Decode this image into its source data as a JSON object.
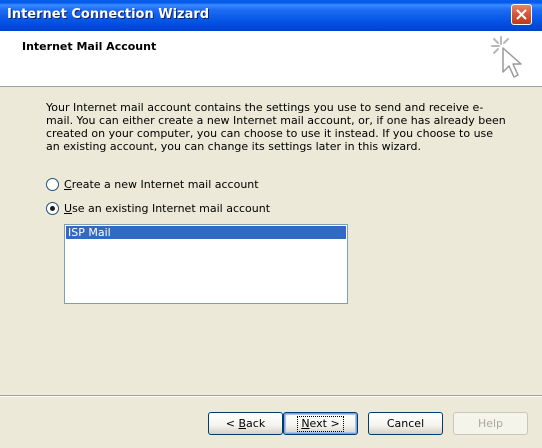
{
  "window": {
    "title": "Internet Connection Wizard"
  },
  "header": {
    "title": "Internet Mail Account"
  },
  "body": {
    "description": "Your Internet mail account contains the settings you use to send and receive e-mail. You can either create a new Internet mail account, or, if one has already been created on your computer, you can choose to use it instead. If you choose to use an existing account, you can change its settings later in this wizard."
  },
  "options": [
    {
      "label_prefix": "",
      "accel": "C",
      "label_rest": "reate a new Internet mail account",
      "checked": false
    },
    {
      "label_prefix": "",
      "accel": "U",
      "label_rest": "se an existing Internet mail account",
      "checked": true
    }
  ],
  "accounts": {
    "items": [
      "ISP Mail"
    ],
    "selected": "ISP Mail"
  },
  "buttons": {
    "back": {
      "prefix": "< ",
      "accel": "B",
      "rest": "ack"
    },
    "next": {
      "accel": "N",
      "rest": "ext >"
    },
    "cancel": "Cancel",
    "help": "Help"
  },
  "icons": {
    "close": "close-icon",
    "wizard": "wizard-cursor-icon"
  }
}
